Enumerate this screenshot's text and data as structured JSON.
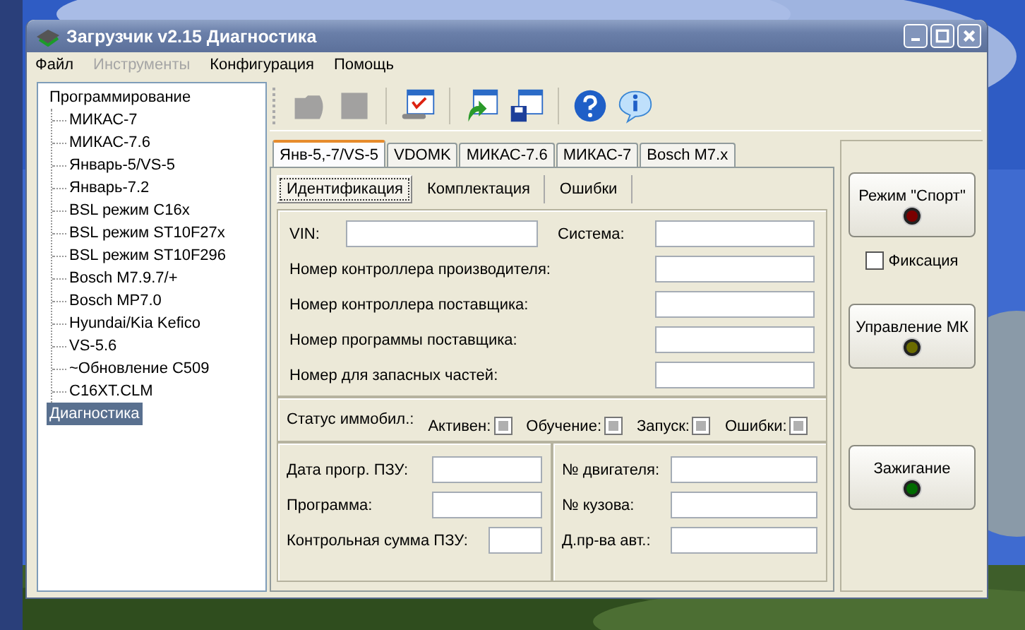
{
  "window": {
    "title": "Загрузчик v2.15 Диагностика"
  },
  "menu": [
    {
      "label": "Файл",
      "disabled": false
    },
    {
      "label": "Инструменты",
      "disabled": true
    },
    {
      "label": "Конфигурация",
      "disabled": false
    },
    {
      "label": "Помощь",
      "disabled": false
    }
  ],
  "tree": [
    {
      "label": "Программирование",
      "selected": false,
      "children": [
        {
          "label": "МИКАС-7",
          "selected": false
        },
        {
          "label": "МИКАС-7.6",
          "selected": false
        },
        {
          "label": "Январь-5/VS-5",
          "selected": false
        },
        {
          "label": "Январь-7.2",
          "selected": false
        },
        {
          "label": "BSL режим C16x",
          "selected": false
        },
        {
          "label": "BSL режим ST10F27x",
          "selected": false
        },
        {
          "label": "BSL режим ST10F296",
          "selected": false
        },
        {
          "label": "Bosch M7.9.7/+",
          "selected": false
        },
        {
          "label": "Bosch MP7.0",
          "selected": false
        },
        {
          "label": "Hyundai/Kia Kefico",
          "selected": false
        },
        {
          "label": "VS-5.6",
          "selected": false
        },
        {
          "label": "~Обновление C509",
          "selected": false
        },
        {
          "label": "C16XT.CLM",
          "selected": false
        }
      ]
    },
    {
      "label": "Диагностика",
      "selected": true
    }
  ],
  "toolbar": [
    {
      "kind": "open",
      "disabled": true
    },
    {
      "kind": "stop",
      "disabled": true
    },
    {
      "kind": "settings",
      "disabled": false
    },
    {
      "kind": "import",
      "disabled": false
    },
    {
      "kind": "save",
      "disabled": false
    },
    {
      "kind": "help",
      "disabled": false
    },
    {
      "kind": "info",
      "disabled": false
    }
  ],
  "tabs": [
    {
      "label": "Янв-5,-7/VS-5",
      "selected": true
    },
    {
      "label": "VDOMK",
      "selected": false
    },
    {
      "label": "МИКАС-7.6",
      "selected": false
    },
    {
      "label": "МИКАС-7",
      "selected": false
    },
    {
      "label": "Bosch M7.x",
      "selected": false
    }
  ],
  "subtabs": [
    {
      "label": "Идентификация",
      "selected": true
    },
    {
      "label": "Комплектация",
      "selected": false
    },
    {
      "label": "Ошибки",
      "selected": false
    }
  ],
  "vin": {
    "label": "VIN:"
  },
  "system": {
    "label": "Система:"
  },
  "id_fields": [
    {
      "label": "Номер контроллера производителя:"
    },
    {
      "label": "Номер контроллера поставщика:"
    },
    {
      "label": "Номер программы поставщика:"
    },
    {
      "label": "Номер для запасных частей:"
    }
  ],
  "immobilizer": {
    "label": "Статус иммобил.:",
    "flags": [
      {
        "label": "Активен:",
        "indeterminate": true
      },
      {
        "label": "Обучение:",
        "indeterminate": true
      },
      {
        "label": "Запуск:",
        "indeterminate": true
      },
      {
        "label": "Ошибки:",
        "indeterminate": true
      }
    ]
  },
  "rom_fields": [
    {
      "label": "Дата прогр. ПЗУ:"
    },
    {
      "label": "Программа:"
    },
    {
      "label": "Контрольная сумма ПЗУ:"
    }
  ],
  "vehicle_fields": [
    {
      "label": "№ двигателя:"
    },
    {
      "label": "№ кузова:"
    },
    {
      "label": "Д.пр-ва авт.:"
    }
  ],
  "sport_button": {
    "label": "Режим \"Спорт\"",
    "color": "#7a0000"
  },
  "fixation": {
    "label": "Фиксация",
    "checked": false
  },
  "mk_button": {
    "label": "Управление МК",
    "color": "#6b6b00"
  },
  "ignition_button": {
    "label": "Зажигание",
    "color": "#006b00"
  }
}
